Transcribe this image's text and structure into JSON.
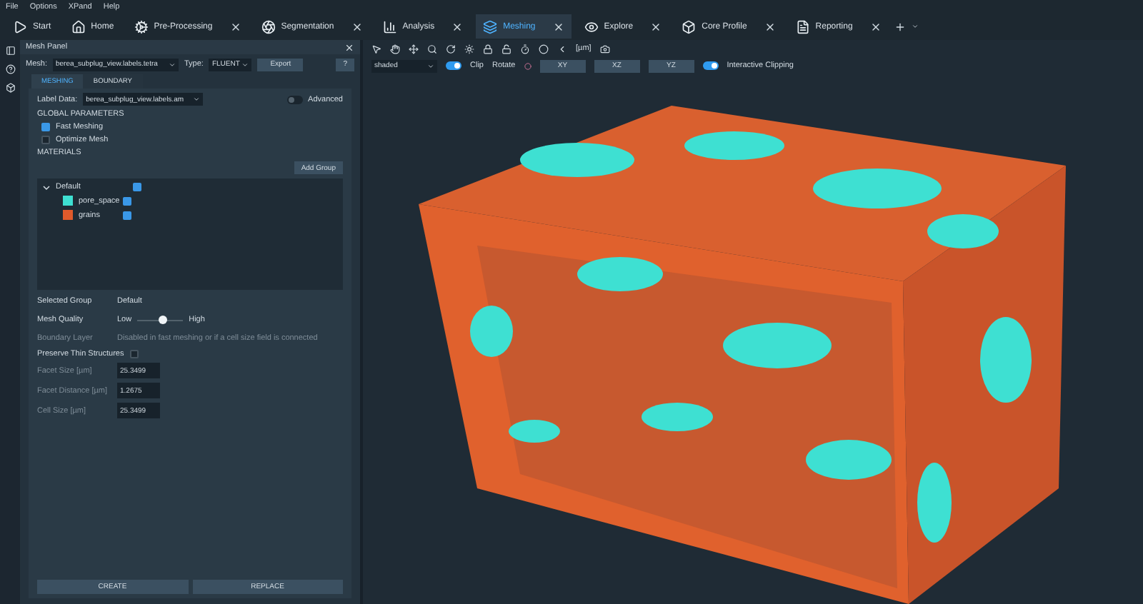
{
  "menu": [
    "File",
    "Options",
    "XPand",
    "Help"
  ],
  "tabs": [
    {
      "label": "Start",
      "selected": false,
      "closable": false
    },
    {
      "label": "Home",
      "selected": false,
      "closable": false
    },
    {
      "label": "Pre-Processing",
      "selected": false,
      "closable": true
    },
    {
      "label": "Segmentation",
      "selected": false,
      "closable": true
    },
    {
      "label": "Analysis",
      "selected": false,
      "closable": true
    },
    {
      "label": "Meshing",
      "selected": true,
      "closable": true
    },
    {
      "label": "Explore",
      "selected": false,
      "closable": true
    },
    {
      "label": "Core Profile",
      "selected": false,
      "closable": true
    },
    {
      "label": "Reporting",
      "selected": false,
      "closable": true
    }
  ],
  "panel": {
    "title": "Mesh Panel",
    "mesh_label": "Mesh:",
    "mesh_value": "berea_subplug_view.labels.tetra",
    "type_label": "Type:",
    "type_value": "FLUENT",
    "export": "Export",
    "help": "?",
    "subtabs": [
      {
        "label": "MESHING",
        "selected": true
      },
      {
        "label": "BOUNDARY",
        "selected": false
      }
    ],
    "label_data_label": "Label Data:",
    "label_data_value": "berea_subplug_view.labels.am",
    "advanced": {
      "label": "Advanced",
      "on": false
    },
    "global_title": "GLOBAL PARAMETERS",
    "options": [
      {
        "label": "Fast Meshing",
        "checked": true
      },
      {
        "label": "Optimize Mesh",
        "checked": false
      }
    ],
    "materials_title": "MATERIALS",
    "add_group": "Add Group",
    "tree": [
      {
        "label": "Default",
        "checked": true,
        "expanded": true,
        "children": [
          {
            "label": "pore_space",
            "color": "#3ee0d2",
            "checked": true
          },
          {
            "label": "grains",
            "color": "#e05a2b",
            "checked": true
          }
        ]
      }
    ],
    "properties": [
      {
        "kind": "text",
        "label": "Selected Group",
        "value": "Default",
        "disabled": false
      },
      {
        "kind": "slider",
        "label": "Mesh Quality",
        "low": "Low",
        "high": "High",
        "level": 0.55,
        "disabled": false
      },
      {
        "kind": "text",
        "label": "Boundary Layer",
        "value": "Disabled in fast meshing or if a cell size field is connected",
        "disabled": true
      },
      {
        "kind": "checkbox",
        "label": "Preserve Thin Structures",
        "checked": false,
        "disabled": false
      },
      {
        "kind": "field",
        "label": "Facet Size [µm]",
        "value": "25.3499",
        "disabled": true
      },
      {
        "kind": "field",
        "label": "Facet Distance [µm]",
        "value": "1.2675",
        "disabled": true
      },
      {
        "kind": "field",
        "label": "Cell Size [µm]",
        "value": "25.3499",
        "disabled": true
      }
    ],
    "buttons": [
      "CREATE",
      "REPLACE"
    ]
  },
  "viewer": {
    "unit": "[µm]",
    "shading": "shaded",
    "clip": {
      "label": "Clip",
      "on": true
    },
    "rotate": "Rotate",
    "planes": [
      "XY",
      "XZ",
      "YZ"
    ],
    "interactive_clipping": {
      "label": "Interactive Clipping",
      "on": true
    }
  }
}
